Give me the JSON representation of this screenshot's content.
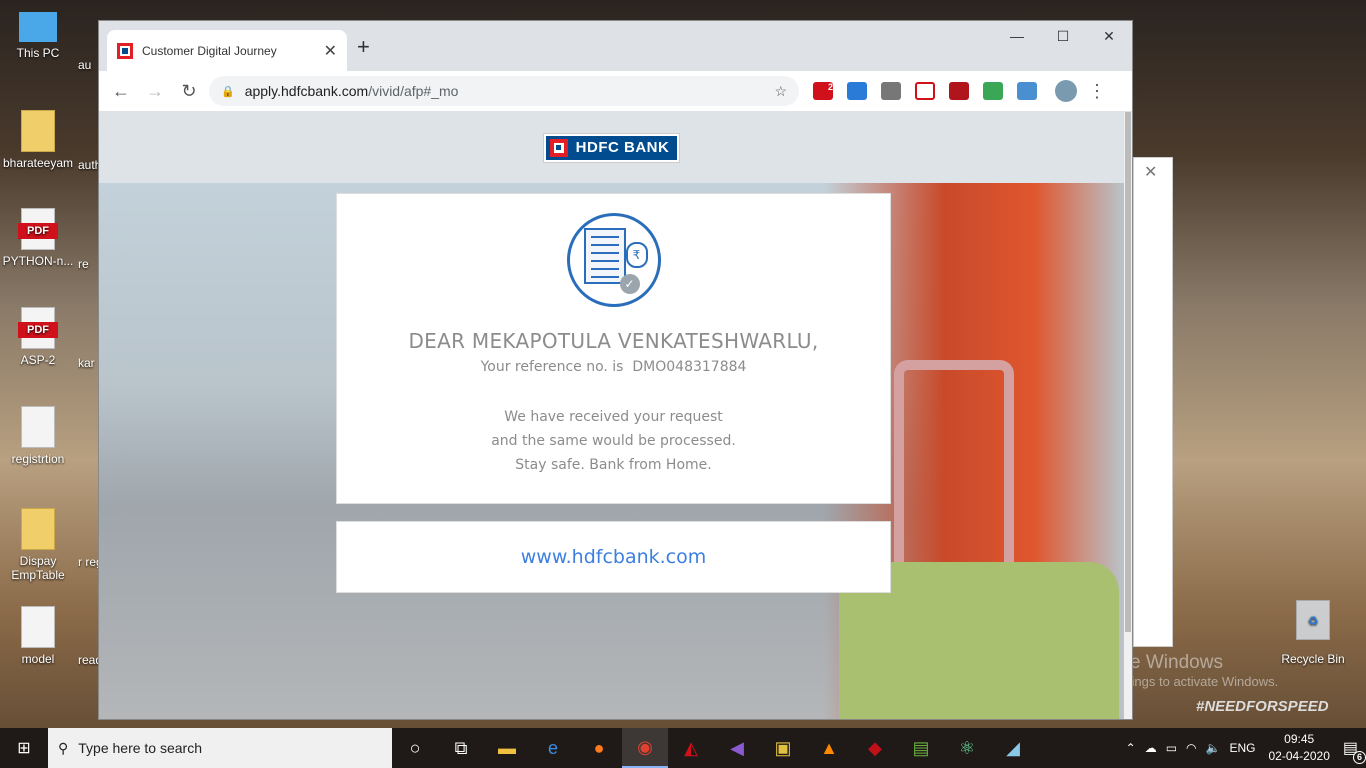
{
  "desktop": {
    "icons": [
      {
        "label": "This PC",
        "type": "pc"
      },
      {
        "label": "bharateeyam",
        "type": "folder"
      },
      {
        "label": "PYTHON-n...",
        "type": "pdf"
      },
      {
        "label": "ASP-2",
        "type": "pdf"
      },
      {
        "label": "registrtion",
        "type": "doc"
      },
      {
        "label": "Dispay EmpTable",
        "type": "folder"
      },
      {
        "label": "model",
        "type": "doc"
      }
    ],
    "partial_labels": [
      "au",
      "auth tok",
      "re",
      "kar",
      "r reg",
      "read pag"
    ],
    "pdf_badge": "PDF",
    "recycle_bin": "Recycle Bin",
    "watermark_title": "Activate Windows",
    "watermark_sub": "Go to Settings to activate Windows.",
    "wallpaper_text": "#NEEDFORSPEED"
  },
  "browser": {
    "tab_title": "Customer Digital Journey",
    "url_host": "apply.hdfcbank.com",
    "url_path": "/vivid/afp#_mo",
    "ext_badge": "2"
  },
  "page": {
    "bank_name": "HDFC BANK",
    "greeting": "DEAR MEKAPOTULA VENKATESHWARLU,",
    "ref_label": "Your reference no. is",
    "ref_number": "DMO048317884",
    "msg_lines": [
      "We have received your request",
      "and the same would be processed.",
      "Stay safe. Bank from Home."
    ],
    "link": "www.hdfcbank.com"
  },
  "taskbar": {
    "search_placeholder": "Type here to search",
    "lang": "ENG",
    "time": "09:45",
    "date": "02-04-2020",
    "notifications": "6"
  },
  "colors": {
    "brand_blue": "#004c8f",
    "brand_red": "#e31e24",
    "link": "#3d7fe0"
  }
}
